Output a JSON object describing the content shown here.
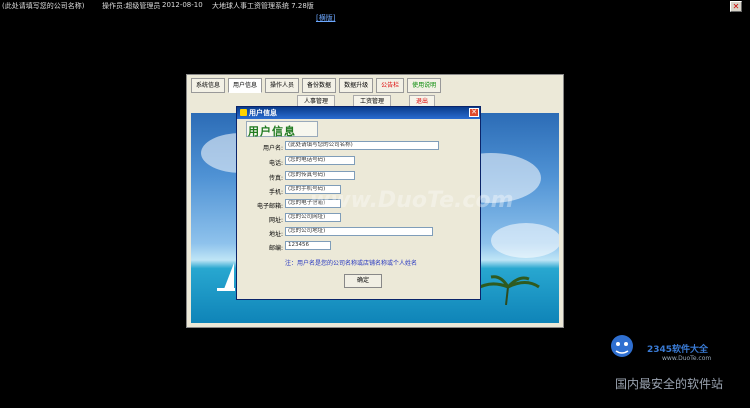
{
  "app": {
    "company": "(此处请填写您的公司名称)",
    "operator": "操作员:超级管理员",
    "date": "2012-08-10",
    "system_name": "大地球人事工资管理系统 7.28版",
    "top_link": "[横版]",
    "close_glyph": "✕"
  },
  "tabs": [
    {
      "label": "系统信息",
      "color": "#000000"
    },
    {
      "label": "用户信息",
      "color": "#000000"
    },
    {
      "label": "操作人员",
      "color": "#000000"
    },
    {
      "label": "备份数据",
      "color": "#000000"
    },
    {
      "label": "数据升级",
      "color": "#000000"
    },
    {
      "label": "公告栏",
      "color": "#dd0000"
    },
    {
      "label": "使用说明",
      "color": "#008800"
    }
  ],
  "subnav": {
    "hr": "人事管理",
    "payroll": "工资管理",
    "logout": "退出"
  },
  "dialog": {
    "title": "用户信息",
    "heading": "用户信息",
    "close_glyph": "✕",
    "fields": [
      {
        "label": "用户名:",
        "value": "(此处请填写您的公司名称)"
      },
      {
        "label": "电话:",
        "value": "(您的电话号码)"
      },
      {
        "label": "传真:",
        "value": "(您的传真号码)"
      },
      {
        "label": "手机:",
        "value": "(您的手机号码)"
      },
      {
        "label": "电子邮箱:",
        "value": "(您的电子信箱)"
      },
      {
        "label": "网址:",
        "value": "(您的公司网址)"
      },
      {
        "label": "地址:",
        "value": "(您的公司地址)"
      },
      {
        "label": "邮编:",
        "value": "123456"
      }
    ],
    "note": "注：用户名是您的公司名称或店铺名称或个人姓名",
    "ok_label": "确定"
  },
  "watermark": {
    "text": "www.DuoTe.com",
    "logo_main": "2345软件大全",
    "logo_sub": "www.DuoTe.com",
    "tagline": "国内最安全的软件站"
  },
  "colors": {
    "background": "#000000",
    "panel": "#ece9d8",
    "dialog_title": "#0a3c8c",
    "heading": "#1f7a1f",
    "note": "#2434c0"
  }
}
